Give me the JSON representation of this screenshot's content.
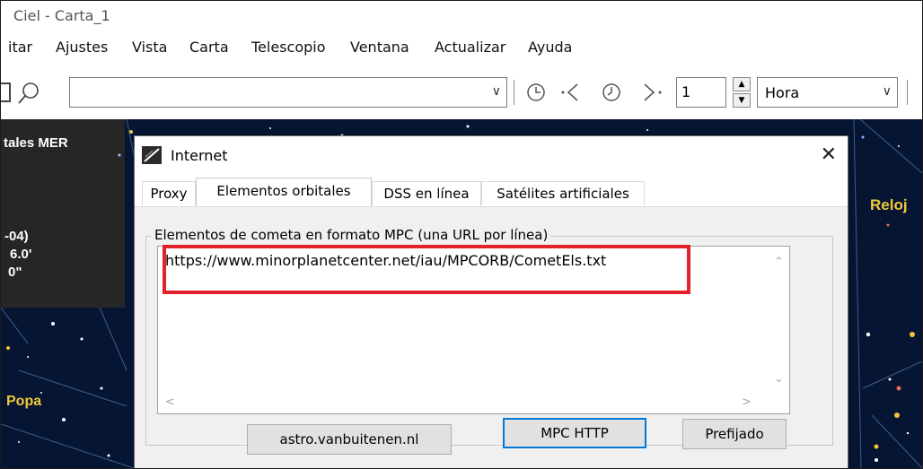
{
  "window": {
    "title": "Ciel - Carta_1"
  },
  "menu": [
    "itar",
    "Ajustes",
    "Vista",
    "Carta",
    "Telescopio",
    "Ventana",
    "Actualizar",
    "Ayuda"
  ],
  "toolbar": {
    "search_value": "",
    "step_value": "1",
    "unit_value": "Hora",
    "icons": [
      "document-icon",
      "search-icon",
      "dropdown-icon",
      "clock-icon",
      "step-back-icon",
      "clock-alt-icon",
      "step-forward-icon"
    ]
  },
  "sky": {
    "labels": {
      "mer": "tales MER",
      "coord1": "-04)",
      "coord2": "6.0'",
      "coord3": "0\"",
      "popa": "Popa",
      "reloj": "Reloj"
    },
    "colors": {
      "background": "#061532",
      "panel": "#262626"
    }
  },
  "dialog": {
    "title": "Internet",
    "tabs": [
      "Proxy",
      "Elementos orbitales",
      "DSS en línea",
      "Satélites artificiales"
    ],
    "active_tab": "Elementos orbitales",
    "group_label": "Elementos de cometa en formato MPC (una URL por línea)",
    "memo_lines": [
      "https://www.minorplanetcenter.net/iau/MPCORB/CometEls.txt"
    ],
    "buttons": {
      "astro": "astro.vanbuitenen.nl",
      "mpc_http": "MPC HTTP",
      "default": "Prefijado"
    },
    "highlight_color": "#e3212a",
    "accent_color": "#0078d7"
  }
}
